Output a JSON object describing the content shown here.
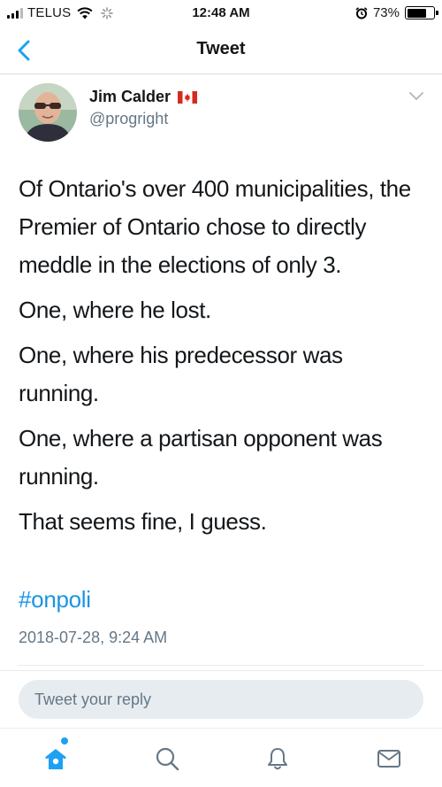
{
  "status_bar": {
    "carrier": "TELUS",
    "time": "12:48 AM",
    "battery_percent_label": "73%",
    "battery_level": 0.73
  },
  "nav": {
    "title": "Tweet",
    "back_icon": "chevron-left-icon"
  },
  "author": {
    "name": "Jim Calder",
    "handle": "@progright",
    "flag_icon": "canada-flag-icon"
  },
  "tweet": {
    "paragraphs": [
      "Of Ontario's over 400 municipalities, the Premier of Ontario chose to directly meddle in the elections of only 3.",
      "One, where he lost.",
      "One, where his predecessor was running.",
      "One, where a partisan opponent was running.",
      "That seems fine, I guess."
    ],
    "hashtag": "#onpoli",
    "timestamp": "2018-07-28, 9:24 AM"
  },
  "reply": {
    "placeholder": "Tweet your reply"
  },
  "tabs": [
    {
      "icon": "home-icon",
      "active": true
    },
    {
      "icon": "search-icon",
      "active": false
    },
    {
      "icon": "bell-icon",
      "active": false
    },
    {
      "icon": "mail-icon",
      "active": false
    }
  ],
  "colors": {
    "accent": "#1da1f2",
    "hashtag": "#1b95e0",
    "secondary_text": "#657786"
  }
}
